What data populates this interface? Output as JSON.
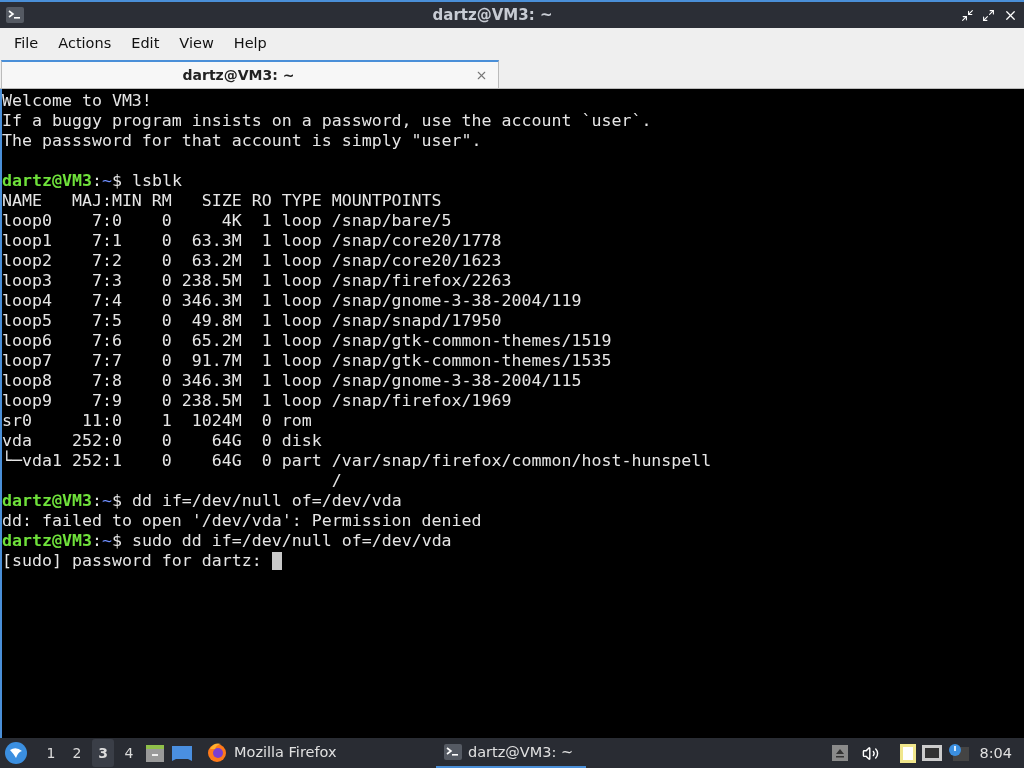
{
  "window": {
    "title": "dartz@VM3: ~"
  },
  "menu": [
    "File",
    "Actions",
    "Edit",
    "View",
    "Help"
  ],
  "tabs": [
    {
      "label": "dartz@VM3: ~",
      "selected": true
    }
  ],
  "terminal": {
    "lines": [
      {
        "kind": "text",
        "text": "Welcome to VM3!"
      },
      {
        "kind": "text",
        "text": "If a buggy program insists on a password, use the account `user`."
      },
      {
        "kind": "text",
        "text": "The passsword for that account is simply \"user\"."
      },
      {
        "kind": "blank"
      },
      {
        "kind": "prompt",
        "user": "dartz@VM3",
        "separator": ":",
        "path": "~",
        "symbol": "$",
        "command": "lsblk"
      },
      {
        "kind": "text",
        "text": "NAME   MAJ:MIN RM   SIZE RO TYPE MOUNTPOINTS"
      },
      {
        "kind": "text",
        "text": "loop0    7:0    0     4K  1 loop /snap/bare/5"
      },
      {
        "kind": "text",
        "text": "loop1    7:1    0  63.3M  1 loop /snap/core20/1778"
      },
      {
        "kind": "text",
        "text": "loop2    7:2    0  63.2M  1 loop /snap/core20/1623"
      },
      {
        "kind": "text",
        "text": "loop3    7:3    0 238.5M  1 loop /snap/firefox/2263"
      },
      {
        "kind": "text",
        "text": "loop4    7:4    0 346.3M  1 loop /snap/gnome-3-38-2004/119"
      },
      {
        "kind": "text",
        "text": "loop5    7:5    0  49.8M  1 loop /snap/snapd/17950"
      },
      {
        "kind": "text",
        "text": "loop6    7:6    0  65.2M  1 loop /snap/gtk-common-themes/1519"
      },
      {
        "kind": "text",
        "text": "loop7    7:7    0  91.7M  1 loop /snap/gtk-common-themes/1535"
      },
      {
        "kind": "text",
        "text": "loop8    7:8    0 346.3M  1 loop /snap/gnome-3-38-2004/115"
      },
      {
        "kind": "text",
        "text": "loop9    7:9    0 238.5M  1 loop /snap/firefox/1969"
      },
      {
        "kind": "text",
        "text": "sr0     11:0    1  1024M  0 rom"
      },
      {
        "kind": "text",
        "text": "vda    252:0    0    64G  0 disk"
      },
      {
        "kind": "text",
        "text": "└─vda1 252:1    0    64G  0 part /var/snap/firefox/common/host-hunspell"
      },
      {
        "kind": "text",
        "text": "                                 /"
      },
      {
        "kind": "prompt",
        "user": "dartz@VM3",
        "separator": ":",
        "path": "~",
        "symbol": "$",
        "command": "dd if=/dev/null of=/dev/vda"
      },
      {
        "kind": "text",
        "text": "dd: failed to open '/dev/vda': Permission denied"
      },
      {
        "kind": "prompt",
        "user": "dartz@VM3",
        "separator": ":",
        "path": "~",
        "symbol": "$",
        "command": "sudo dd if=/dev/null of=/dev/vda"
      },
      {
        "kind": "text",
        "text": "[sudo] password for dartz:",
        "cursor": true
      }
    ]
  },
  "taskbar": {
    "workspaces": [
      {
        "label": "1",
        "selected": false
      },
      {
        "label": "2",
        "selected": false
      },
      {
        "label": "3",
        "selected": true
      },
      {
        "label": "4",
        "selected": false
      }
    ],
    "tasks": [
      {
        "kind": "browser",
        "label": "Mozilla Firefox",
        "selected": false
      },
      {
        "kind": "terminal",
        "label": "dartz@VM3: ~",
        "selected": true
      }
    ],
    "clock": "8:04"
  }
}
